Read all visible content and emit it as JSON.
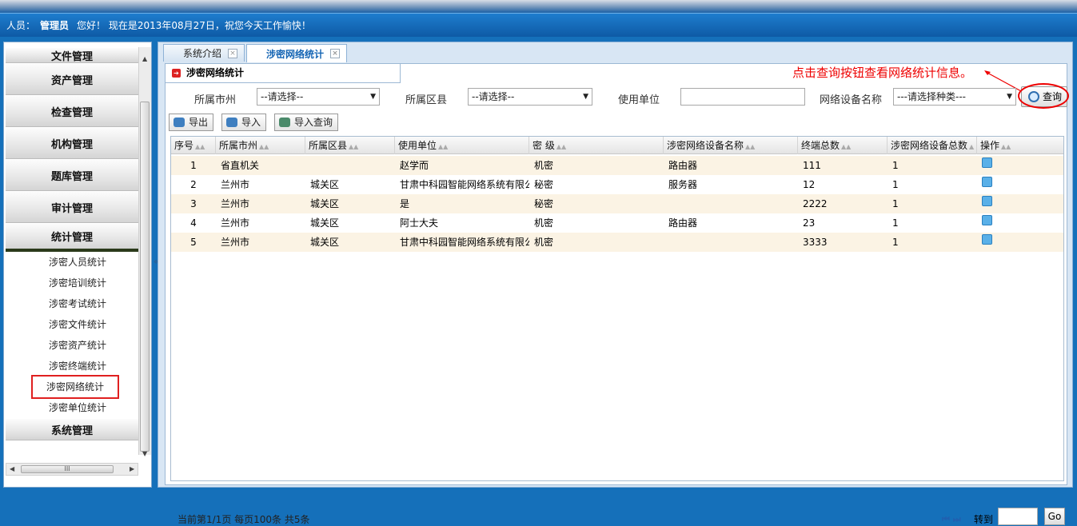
{
  "topbar": {
    "user_label": "人员：",
    "user_name": "管理员",
    "greeting": "您好！  现在是2013年08月27日，祝您今天工作愉快！"
  },
  "sidebar": {
    "sections": [
      {
        "label": "文件管理"
      },
      {
        "label": "资产管理"
      },
      {
        "label": "检查管理"
      },
      {
        "label": "机构管理"
      },
      {
        "label": "题库管理"
      },
      {
        "label": "审计管理"
      },
      {
        "label": "统计管理"
      }
    ],
    "stat_items": [
      "涉密人员统计",
      "涉密培训统计",
      "涉密考试统计",
      "涉密文件统计",
      "涉密资产统计",
      "涉密终端统计",
      "涉密网络统计",
      "涉密单位统计"
    ],
    "last_section": "系统管理",
    "collapse": "«",
    "hscroll_grip": "III"
  },
  "tabs": [
    {
      "label": "系统介绍"
    },
    {
      "label": "涉密网络统计"
    }
  ],
  "tab_close": "×",
  "panel": {
    "title": "涉密网络统计",
    "annotation": "点击查询按钮查看网络统计信息。",
    "filters": {
      "city_label": "所属市州",
      "city_value": "--请选择--",
      "district_label": "所属区县",
      "district_value": "--请选择--",
      "unit_label": "使用单位",
      "unit_value": "",
      "device_label": "网络设备名称",
      "device_value": "---请选择种类---"
    },
    "query_button": "查询",
    "toolbar": {
      "export": "导出",
      "import": "导入",
      "import_query": "导入查询"
    }
  },
  "grid": {
    "columns": [
      "序号",
      "所属市州",
      "所属区县",
      "使用单位",
      "密 级",
      "涉密网络设备名称",
      "终端总数",
      "涉密网络设备总数",
      "操作"
    ],
    "rows": [
      [
        "1",
        "省直机关",
        "",
        "赵学而",
        "机密",
        "路由器",
        "111",
        "1"
      ],
      [
        "2",
        "兰州市",
        "城关区",
        "甘肃中科园智能网络系统有限公",
        "秘密",
        "服务器",
        "12",
        "1"
      ],
      [
        "3",
        "兰州市",
        "城关区",
        "是",
        "秘密",
        "",
        "2222",
        "1"
      ],
      [
        "4",
        "兰州市",
        "城关区",
        "阿士大夫",
        "机密",
        "路由器",
        "23",
        "1"
      ],
      [
        "5",
        "兰州市",
        "城关区",
        "甘肃中科园智能网络系统有限公",
        "机密",
        "",
        "3333",
        "1"
      ]
    ]
  },
  "pager": {
    "summary": "当前第1/1页  每页100条  共5条",
    "nav": "⏮ ⏭",
    "goto_label": "转到",
    "go_button": "Go"
  }
}
